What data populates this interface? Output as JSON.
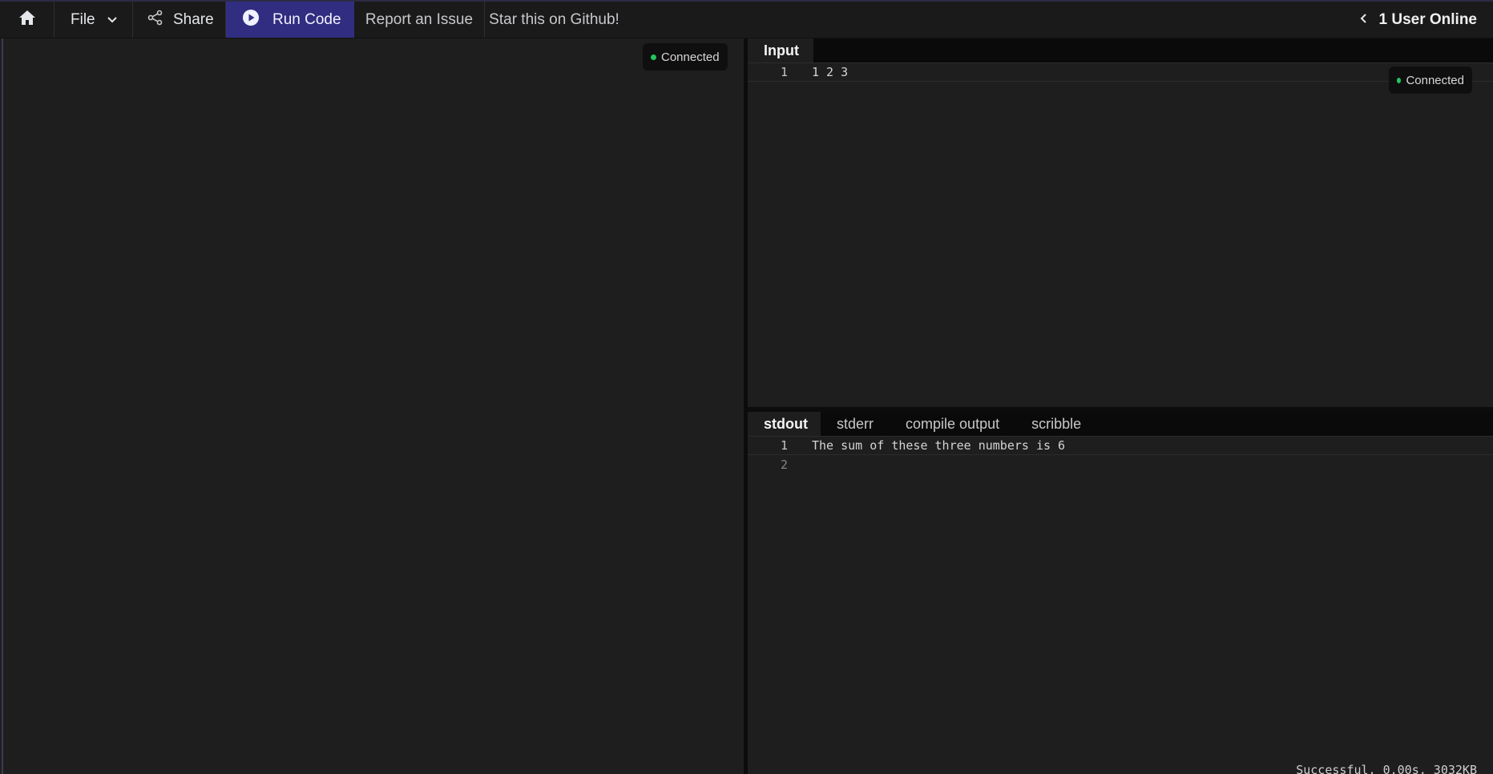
{
  "navbar": {
    "home_icon": "home-icon",
    "file_label": "File",
    "share_label": "Share",
    "run_label": "Run Code",
    "report_label": "Report an Issue",
    "star_label": "Star this on Github!",
    "users_online": "1 User Online",
    "run_color": "#312e81"
  },
  "code_panel": {
    "connection_status": "Connected"
  },
  "input_panel": {
    "tab_label": "Input",
    "connection_status": "Connected",
    "lines": [
      {
        "number": "1",
        "text": "1 2 3"
      }
    ]
  },
  "output_panel": {
    "tabs": [
      "stdout",
      "stderr",
      "compile output",
      "scribble"
    ],
    "active_tab": "stdout",
    "lines": [
      {
        "number": "1",
        "text": "The sum of these three numbers is 6"
      },
      {
        "number": "2",
        "text": ""
      }
    ],
    "status": "Successful, 0.00s, 3032KB"
  },
  "colors": {
    "connected_dot": "#22c55e"
  }
}
